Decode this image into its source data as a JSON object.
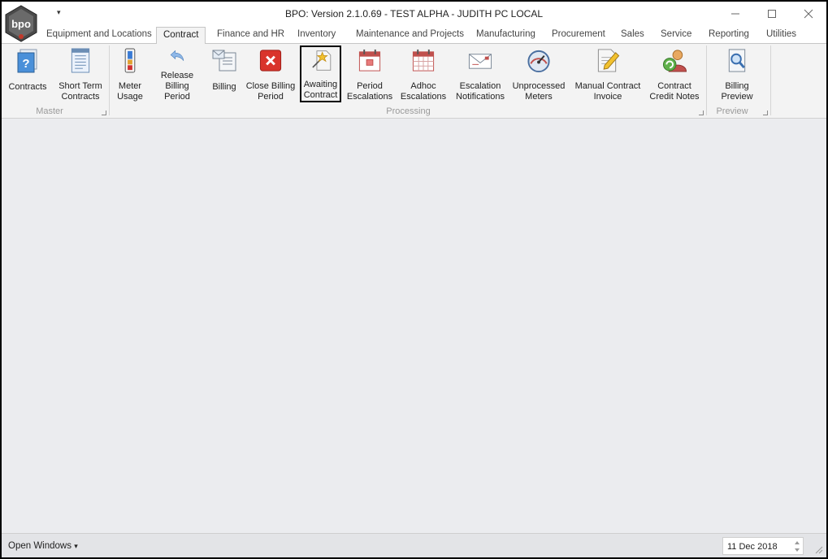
{
  "window": {
    "title": "BPO: Version 2.1.0.69 - TEST ALPHA - JUDITH PC LOCAL",
    "qat_glyph": "▾",
    "logo_text": "bpo"
  },
  "tabs": [
    {
      "label": "Equipment and Locations",
      "active": false
    },
    {
      "label": "Contract",
      "active": true
    },
    {
      "label": "Finance and HR",
      "active": false
    },
    {
      "label": "Inventory",
      "active": false
    },
    {
      "label": "Maintenance and Projects",
      "active": false
    },
    {
      "label": "Manufacturing",
      "active": false
    },
    {
      "label": "Procurement",
      "active": false
    },
    {
      "label": "Sales",
      "active": false
    },
    {
      "label": "Service",
      "active": false
    },
    {
      "label": "Reporting",
      "active": false
    },
    {
      "label": "Utilities",
      "active": false
    }
  ],
  "ribbon": {
    "groups": [
      {
        "label": "Master"
      },
      {
        "label": "Processing"
      },
      {
        "label": "Preview"
      }
    ],
    "buttons": [
      {
        "label": "Contracts",
        "icon": "contract-help-icon"
      },
      {
        "label": "Short Term\nContracts",
        "icon": "document-lines-icon"
      },
      {
        "label": "Meter\nUsage",
        "icon": "meter-icon"
      },
      {
        "label": "Release\nBilling Period",
        "icon": "undo-arrow-icon"
      },
      {
        "label": "Billing",
        "icon": "billing-icon"
      },
      {
        "label": "Close Billing\nPeriod",
        "icon": "close-x-icon"
      },
      {
        "label": "Awaiting\nContract",
        "icon": "magic-wand-icon",
        "selected": true
      },
      {
        "label": "Period\nEscalations",
        "icon": "calendar-icon"
      },
      {
        "label": "Adhoc\nEscalations",
        "icon": "calendar-grid-icon"
      },
      {
        "label": "Escalation\nNotifications",
        "icon": "envelope-icon"
      },
      {
        "label": "Unprocessed\nMeters",
        "icon": "gauge-icon"
      },
      {
        "label": "Manual Contract\nInvoice",
        "icon": "pencil-document-icon"
      },
      {
        "label": "Contract\nCredit Notes",
        "icon": "user-refresh-icon"
      },
      {
        "label": "Billing\nPreview",
        "icon": "magnifier-document-icon"
      }
    ]
  },
  "statusbar": {
    "open_windows_label": "Open Windows",
    "dropdown_glyph": "▾",
    "date_value": "11 Dec 2018"
  },
  "window_controls": {
    "minimize_glyph": "—",
    "maximize_glyph": "☐",
    "close_glyph": "✕"
  }
}
